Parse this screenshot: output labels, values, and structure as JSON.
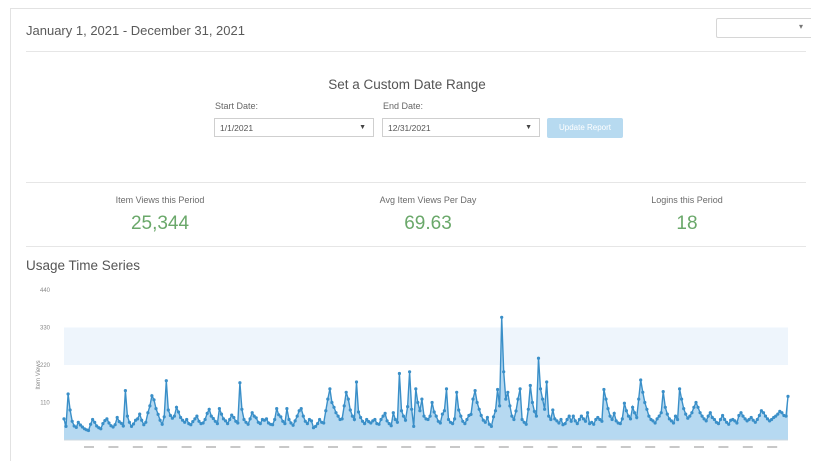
{
  "header": {
    "date_range": "January 1, 2021 - December 31, 2021",
    "dropdown_value": ""
  },
  "custom_range": {
    "title": "Set a Custom Date Range",
    "start_label": "Start Date:",
    "start_value": "1/1/2021",
    "end_label": "End Date:",
    "end_value": "12/31/2021",
    "update_label": "Update Report"
  },
  "stats": [
    {
      "label": "Item Views this Period",
      "value": "25,344"
    },
    {
      "label": "Avg Item Views Per Day",
      "value": "69.63"
    },
    {
      "label": "Logins this Period",
      "value": "18"
    }
  ],
  "usage": {
    "title": "Usage Time Series"
  },
  "colors": {
    "line": "#3a8fc8",
    "area": "#a9d2ef",
    "band": "#eef5fc",
    "stat_value": "#6aa86a",
    "button": "#b7daf0"
  },
  "icons": {
    "dropdown": "chevron-down-icon"
  },
  "chart_data": {
    "type": "line",
    "title": "Usage Time Series",
    "ylabel": "Item Views",
    "ylim": [
      0,
      440
    ],
    "yticks": [
      110,
      220,
      330,
      440
    ],
    "x_start": "2021-01-01",
    "x_end": "2021-12-31",
    "grid": false,
    "values": [
      62,
      40,
      135,
      88,
      55,
      41,
      37,
      52,
      44,
      38,
      33,
      30,
      28,
      46,
      60,
      52,
      41,
      36,
      33,
      48,
      57,
      62,
      50,
      42,
      38,
      45,
      66,
      54,
      49,
      41,
      145,
      70,
      52,
      40,
      47,
      58,
      62,
      76,
      58,
      45,
      52,
      80,
      100,
      130,
      118,
      92,
      75,
      58,
      46,
      68,
      174,
      88,
      72,
      64,
      70,
      96,
      82,
      66,
      58,
      52,
      60,
      48,
      45,
      54,
      62,
      70,
      55,
      48,
      50,
      60,
      78,
      90,
      70,
      63,
      55,
      48,
      92,
      76,
      62,
      56,
      48,
      60,
      73,
      66,
      55,
      50,
      168,
      90,
      60,
      52,
      46,
      62,
      80,
      70,
      65,
      52,
      48,
      60,
      58,
      62,
      50,
      46,
      45,
      60,
      92,
      74,
      68,
      55,
      48,
      92,
      60,
      50,
      43,
      56,
      70,
      86,
      92,
      70,
      55,
      48,
      60,
      56,
      36,
      40,
      48,
      60,
      52,
      50,
      86,
      120,
      150,
      110,
      96,
      80,
      70,
      60,
      62,
      100,
      140,
      120,
      88,
      70,
      60,
      170,
      82,
      66,
      55,
      48,
      60,
      54,
      50,
      56,
      60,
      48,
      46,
      60,
      70,
      78,
      56,
      48,
      42,
      80,
      60,
      52,
      195,
      86,
      70,
      58,
      98,
      200,
      90,
      40,
      150,
      110,
      86,
      120,
      70,
      62,
      60,
      70,
      110,
      82,
      70,
      55,
      50,
      76,
      86,
      150,
      60,
      52,
      48,
      62,
      140,
      88,
      70,
      55,
      48,
      60,
      72,
      75,
      120,
      145,
      110,
      90,
      72,
      58,
      52,
      66,
      46,
      40,
      68,
      86,
      148,
      100,
      360,
      200,
      120,
      140,
      100,
      70,
      60,
      85,
      120,
      150,
      60,
      52,
      46,
      90,
      160,
      110,
      84,
      70,
      240,
      150,
      120,
      90,
      170,
      70,
      60,
      88,
      62,
      56,
      50,
      60,
      45,
      48,
      60,
      70,
      55,
      70,
      56,
      48,
      60,
      70,
      62,
      55,
      80,
      48,
      52,
      46,
      60,
      66,
      60,
      55,
      148,
      120,
      92,
      70,
      60,
      78,
      56,
      50,
      48,
      62,
      108,
      86,
      70,
      62,
      96,
      80,
      66,
      120,
      176,
      140,
      110,
      90,
      70,
      60,
      56,
      50,
      62,
      70,
      80,
      142,
      96,
      76,
      62,
      56,
      50,
      70,
      60,
      150,
      120,
      92,
      76,
      64,
      70,
      80,
      96,
      110,
      96,
      80,
      70,
      62,
      56,
      70,
      80,
      66,
      60,
      52,
      48,
      60,
      72,
      60,
      52,
      46,
      58,
      60,
      56,
      50,
      72,
      80,
      70,
      62,
      56,
      60,
      66,
      58,
      52,
      60,
      72,
      86,
      80,
      70,
      62,
      56,
      60,
      66,
      70,
      76,
      84,
      80,
      72,
      70,
      128
    ]
  }
}
